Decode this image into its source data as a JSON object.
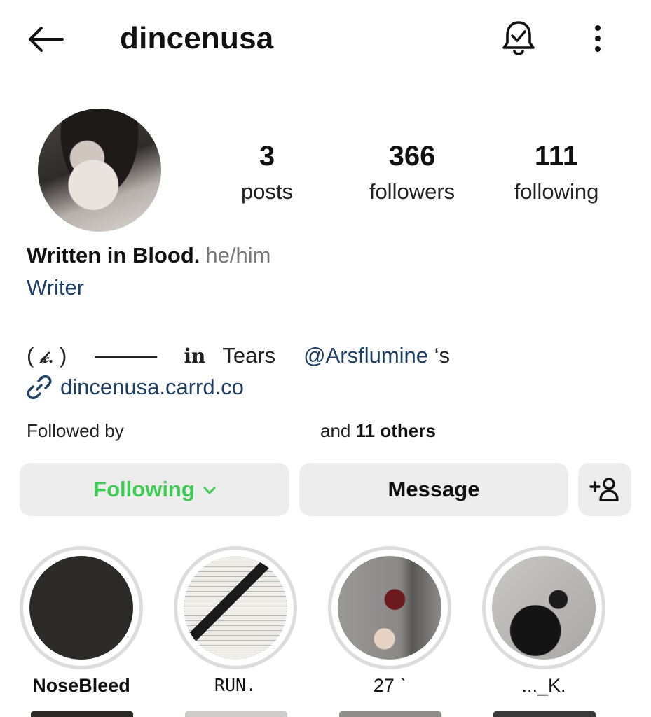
{
  "header": {
    "username": "dincenusa",
    "back_icon": "arrow-left-icon",
    "notification_icon": "bell-check-icon",
    "more_icon": "more-vertical-icon"
  },
  "stats": {
    "posts": {
      "count": "3",
      "label": "posts"
    },
    "followers": {
      "count": "366",
      "label": "followers"
    },
    "following": {
      "count": "111",
      "label": "following"
    }
  },
  "bio": {
    "name": "Written in Blood.",
    "pronouns": "he/him",
    "category": "Writer",
    "line_prefix": "( ",
    "line_glyph": "𝓀.",
    "line_suffix": " )",
    "line_dash": "———",
    "line_in": "in",
    "line_tears": "Tears",
    "mention": "@Arsflumine",
    "mention_suffix": " ‘s",
    "link_icon": "link-icon",
    "link": "dincenusa.carrd.co"
  },
  "followed_by": {
    "prefix": "Followed by",
    "and": "and ",
    "others": "11 others"
  },
  "actions": {
    "following_label": "Following",
    "message_label": "Message",
    "add_user_icon": "add-person-icon",
    "colors": {
      "following_text": "#3ecc55",
      "button_bg": "#ededed",
      "link": "#1e3f66"
    }
  },
  "highlights": [
    {
      "title": "NoseBleed"
    },
    {
      "title": "RUN."
    },
    {
      "title": "27 `"
    },
    {
      "title": "..._K."
    }
  ]
}
